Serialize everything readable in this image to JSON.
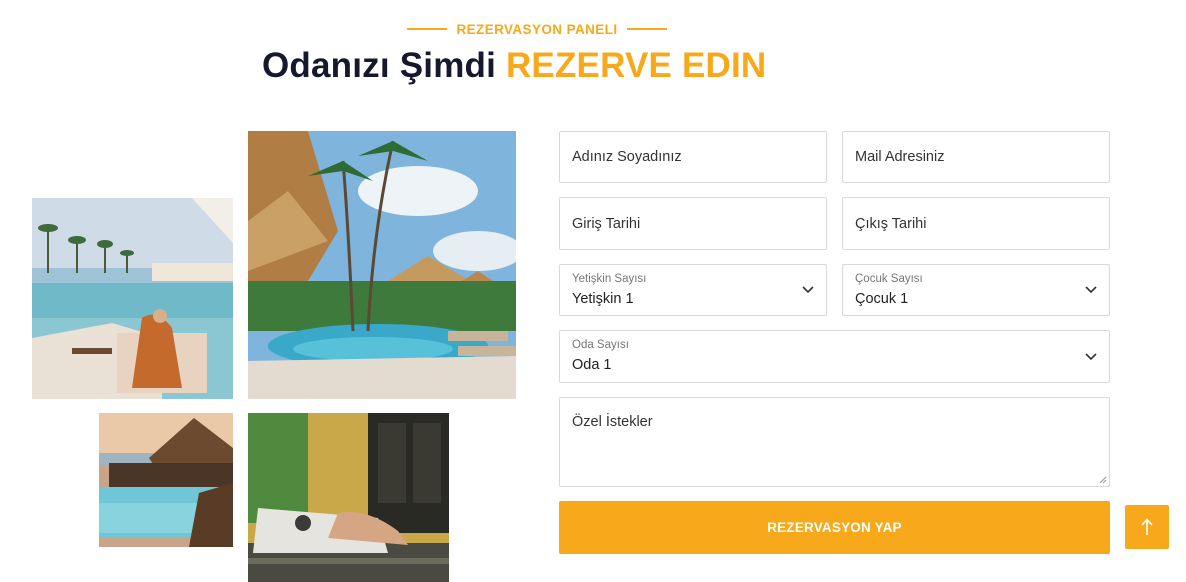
{
  "header": {
    "eyebrow": "REZERVASYON PANELI",
    "title_dark": "Odanızı Şimdi",
    "title_accent": "REZERVE EDIN"
  },
  "colors": {
    "accent": "#f7a81b",
    "dark": "#16192e",
    "border": "#d9d9d9"
  },
  "gallery": {
    "images": [
      {
        "name": "beach-pool-photo"
      },
      {
        "name": "tropical-resort-pool-photo"
      },
      {
        "name": "seaside-pool-photo"
      },
      {
        "name": "sunbathing-terrace-photo"
      }
    ]
  },
  "form": {
    "name_placeholder": "Adınız Soyadınız",
    "mail_placeholder": "Mail Adresiniz",
    "checkin_placeholder": "Giriş Tarihi",
    "checkout_placeholder": "Çıkış Tarihi",
    "adults": {
      "label": "Yetişkin Sayısı",
      "value": "Yetişkin 1"
    },
    "children": {
      "label": "Çocuk Sayısı",
      "value": "Çocuk 1"
    },
    "rooms": {
      "label": "Oda Sayısı",
      "value": "Oda 1"
    },
    "notes_placeholder": "Özel İstekler",
    "submit_label": "REZERVASYON YAP"
  },
  "scroll_top": {
    "icon": "arrow-up-icon"
  }
}
